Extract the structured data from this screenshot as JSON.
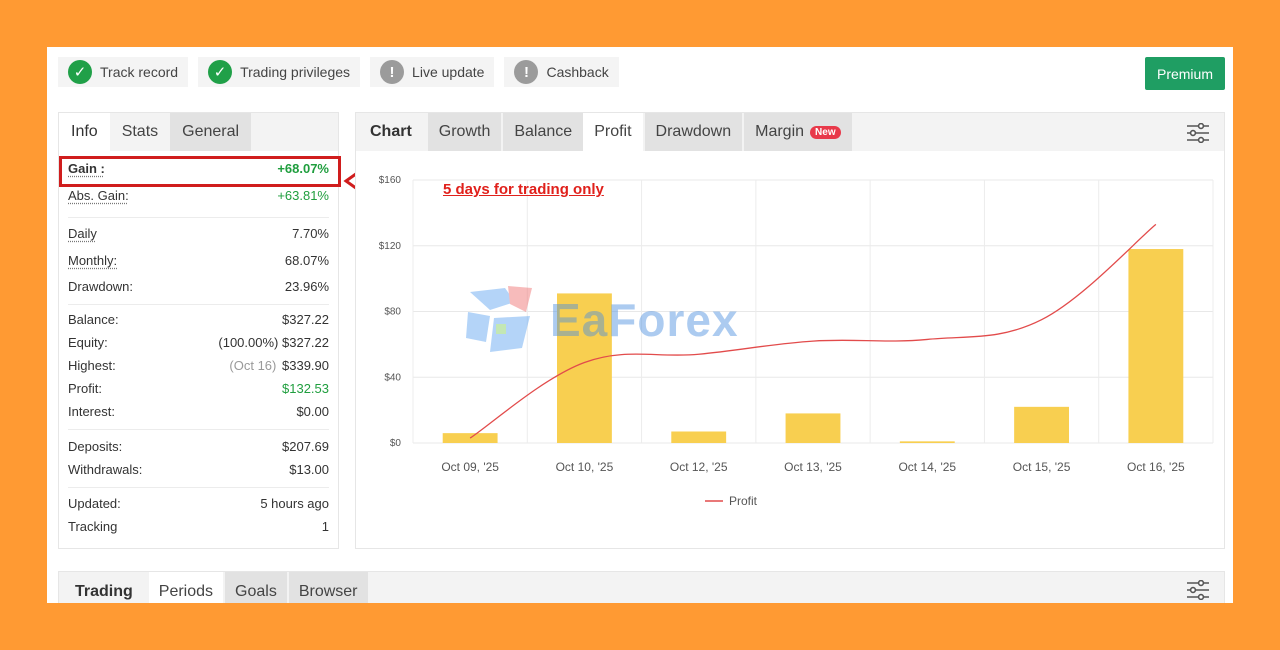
{
  "badges": [
    {
      "label": "Track record",
      "status": "ok"
    },
    {
      "label": "Trading privileges",
      "status": "ok"
    },
    {
      "label": "Live update",
      "status": "warn"
    },
    {
      "label": "Cashback",
      "status": "warn"
    }
  ],
  "premium_label": "Premium",
  "info_tabs": [
    "Info",
    "Stats",
    "General"
  ],
  "gain": {
    "label": "Gain :",
    "value": "+68.07%"
  },
  "abs_gain": {
    "label": "Abs. Gain:",
    "value": "+63.81%"
  },
  "daily": {
    "label": "Daily",
    "value": "7.70%"
  },
  "monthly": {
    "label": "Monthly:",
    "value": "68.07%"
  },
  "drawdown": {
    "label": "Drawdown:",
    "value": "23.96%"
  },
  "balance": {
    "label": "Balance:",
    "value": "$327.22"
  },
  "equity": {
    "label": "Equity:",
    "note": "(100.00%)",
    "value": "$327.22"
  },
  "highest": {
    "label": "Highest:",
    "note": "(Oct 16)",
    "value": "$339.90"
  },
  "profit": {
    "label": "Profit:",
    "value": "$132.53"
  },
  "interest": {
    "label": "Interest:",
    "value": "$0.00"
  },
  "deposits": {
    "label": "Deposits:",
    "value": "$207.69"
  },
  "withdrawals": {
    "label": "Withdrawals:",
    "value": "$13.00"
  },
  "updated": {
    "label": "Updated:",
    "value": "5 hours ago"
  },
  "tracking": {
    "label": "Tracking",
    "value": "1"
  },
  "chart_tabs": {
    "title": "Chart",
    "items": [
      "Growth",
      "Balance",
      "Profit",
      "Drawdown",
      "Margin"
    ],
    "new_badge": "New"
  },
  "annotation": "5 days for trading only",
  "watermark": "EaForex",
  "bottom_tabs": {
    "title": "Trading",
    "items": [
      "Periods",
      "Goals",
      "Browser"
    ]
  },
  "colors": {
    "bar": "#f8cf50",
    "line": "#e24b4b",
    "accent": "#1f9e63",
    "highlight": "#d01d1d"
  },
  "chart_data": {
    "type": "bar",
    "categories": [
      "Oct 09, '25",
      "Oct 10, '25",
      "Oct 12, '25",
      "Oct 13, '25",
      "Oct 14, '25",
      "Oct 15, '25",
      "Oct 16, '25"
    ],
    "series": [
      {
        "type": "bar",
        "values": [
          6,
          91,
          7,
          18,
          1,
          22,
          118
        ]
      },
      {
        "name": "Profit",
        "type": "line",
        "values": [
          3,
          49,
          54,
          62,
          63,
          75,
          133
        ]
      }
    ],
    "yticks": [
      "$0",
      "$40",
      "$80",
      "$120",
      "$160"
    ],
    "ylim": [
      0,
      160
    ],
    "legend": "bottom",
    "grid": true
  }
}
